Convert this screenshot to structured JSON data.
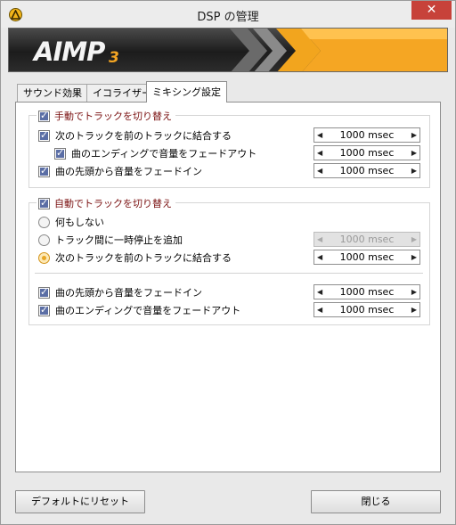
{
  "window": {
    "title": "DSP の管理",
    "close_glyph": "✕"
  },
  "banner": {
    "logo": "AIMP",
    "logo_sub": "3"
  },
  "tabs": [
    {
      "label": "サウンド効果",
      "active": false
    },
    {
      "label": "イコライザー",
      "active": false
    },
    {
      "label": "ミキシング設定",
      "active": true
    }
  ],
  "manual": {
    "title": "手動でトラックを切り替え",
    "checked": true,
    "options": [
      {
        "label": "次のトラックを前のトラックに結合する",
        "checked": true,
        "value": "1000 msec"
      },
      {
        "label": "曲のエンディングで音量をフェードアウト",
        "checked": true,
        "value": "1000 msec"
      },
      {
        "label": "曲の先頭から音量をフェードイン",
        "checked": true,
        "value": "1000 msec"
      }
    ]
  },
  "auto": {
    "title": "自動でトラックを切り替え",
    "checked": true,
    "radios": [
      {
        "label": "何もしない",
        "selected": false
      },
      {
        "label": "トラック間に一時停止を追加",
        "selected": false,
        "value": "1000 msec",
        "disabled": true
      },
      {
        "label": "次のトラックを前のトラックに結合する",
        "selected": true,
        "value": "1000 msec"
      }
    ],
    "options": [
      {
        "label": "曲の先頭から音量をフェードイン",
        "checked": true,
        "value": "1000 msec"
      },
      {
        "label": "曲のエンディングで音量をフェードアウト",
        "checked": true,
        "value": "1000 msec"
      }
    ]
  },
  "buttons": {
    "reset": "デフォルトにリセット",
    "close": "閉じる"
  },
  "spin_arrows": {
    "left": "◀",
    "right": "▶"
  },
  "colors": {
    "accent": "#e8a626",
    "group_title": "#7a1010",
    "close": "#c7423a"
  }
}
